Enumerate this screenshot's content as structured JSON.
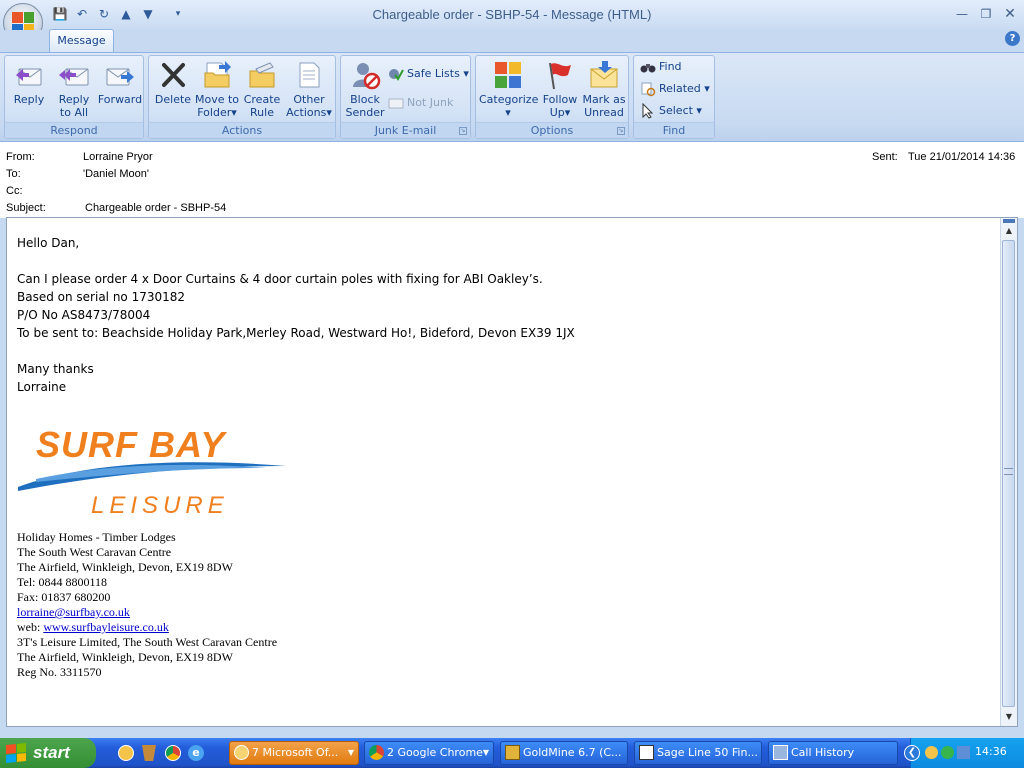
{
  "window": {
    "title": "Chargeable order - SBHP-54  -  Message (HTML)"
  },
  "ribbon": {
    "tab": "Message",
    "groups": {
      "respond": {
        "label": "Respond",
        "reply": "Reply",
        "reply_all_1": "Reply",
        "reply_all_2": "to All",
        "forward": "Forward"
      },
      "actions": {
        "label": "Actions",
        "delete": "Delete",
        "move_1": "Move to",
        "move_2": "Folder",
        "create_1": "Create",
        "create_2": "Rule",
        "other_1": "Other",
        "other_2": "Actions"
      },
      "junk": {
        "label": "Junk E-mail",
        "block_1": "Block",
        "block_2": "Sender",
        "safe_lists": "Safe Lists",
        "not_junk": "Not Junk"
      },
      "options": {
        "label": "Options",
        "categorize": "Categorize",
        "follow_1": "Follow",
        "follow_2": "Up",
        "mark_1": "Mark as",
        "mark_2": "Unread"
      },
      "find": {
        "label": "Find",
        "find": "Find",
        "related": "Related",
        "select": "Select"
      }
    }
  },
  "header": {
    "from_label": "From:",
    "from_value": "Lorraine Pryor",
    "to_label": "To:",
    "to_value": "'Daniel Moon'",
    "cc_label": "Cc:",
    "cc_value": "",
    "subject_label": "Subject:",
    "subject_value": "Chargeable order - SBHP-54",
    "sent_label": "Sent:",
    "sent_value": "Tue 21/01/2014 14:36"
  },
  "body": {
    "greeting": "Hello Dan,",
    "line1": "Can I please order 4 x Door Curtains  &  4 door curtain poles with fixing for ABI Oakley’s.",
    "line2": "Based on serial no 1730182",
    "line3": "P/O No AS8473/78004",
    "line4": "To be sent to: Beachside Holiday Park,Merley Road, Westward Ho!, Bideford, Devon EX39 1JX",
    "thanks": "Many thanks",
    "name": "Lorraine"
  },
  "logo": {
    "top": "SURF BAY",
    "bottom": "LEISURE"
  },
  "signature": {
    "l1": "Holiday Homes - Timber Lodges",
    "l2": "The South West Caravan Centre",
    "l3": "The Airfield, Winkleigh, Devon, EX19 8DW",
    "l4": "Tel: 0844 8800118",
    "l5": "Fax: 01837 680200",
    "email": "lorraine@surfbay.co.uk",
    "web_label": "web: ",
    "web": "www.surfbayleisure.co.uk",
    "l8": "3T's Leisure Limited, The South West Caravan Centre",
    "l9": "The Airfield, Winkleigh, Devon, EX19 8DW",
    "l10": "Reg No. 3311570"
  },
  "taskbar": {
    "start": "start",
    "items": [
      "7 Microsoft Of...",
      "2 Google Chrome",
      "GoldMine 6.7 (C...",
      "Sage Line 50 Fin...",
      "Call History"
    ],
    "clock": "14:36"
  },
  "colors": {
    "accent": "#15428b",
    "link": "#0000cc",
    "logo_orange": "#f07f1e",
    "logo_blue": "#1f6fbf"
  }
}
